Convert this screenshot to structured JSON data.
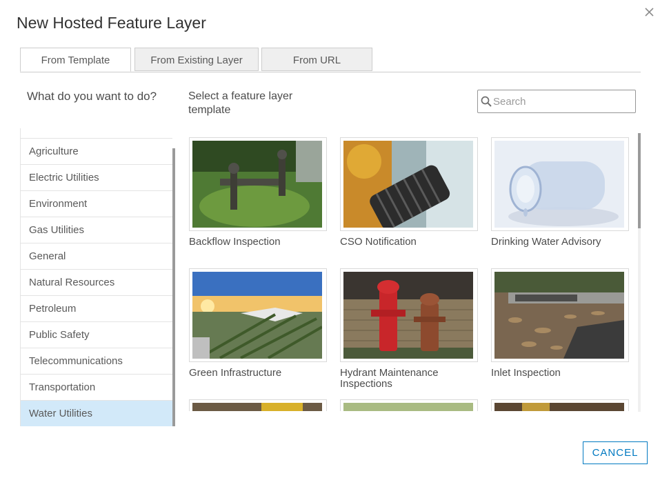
{
  "dialog": {
    "title": "New Hosted Feature Layer",
    "close_icon": "close-icon"
  },
  "tabs": [
    {
      "label": "From Template",
      "active": true
    },
    {
      "label": "From Existing Layer",
      "active": false
    },
    {
      "label": "From URL",
      "active": false
    }
  ],
  "left_panel": {
    "heading": "What do you want to do?",
    "categories": [
      "Agriculture",
      "Electric Utilities",
      "Environment",
      "Gas Utilities",
      "General",
      "Natural Resources",
      "Petroleum",
      "Public Safety",
      "Telecommunications",
      "Transportation",
      "Water Utilities"
    ],
    "selected": "Water Utilities"
  },
  "right_panel": {
    "heading": "Select a feature layer template",
    "search": {
      "placeholder": "Search",
      "value": "",
      "icon": "search-icon"
    },
    "templates": [
      {
        "label": "Backflow Inspection",
        "thumb": "backflow-thumbnail"
      },
      {
        "label": "CSO Notification",
        "thumb": "cso-thumbnail"
      },
      {
        "label": "Drinking Water Advisory",
        "thumb": "drinking-water-thumbnail"
      },
      {
        "label": "Green Infrastructure",
        "thumb": "green-infrastructure-thumbnail"
      },
      {
        "label": "Hydrant Maintenance Inspections",
        "thumb": "hydrant-thumbnail"
      },
      {
        "label": "Inlet Inspection",
        "thumb": "inlet-thumbnail"
      }
    ]
  },
  "footer": {
    "cancel_label": "CANCEL"
  },
  "colors": {
    "accent": "#0079c1",
    "selected_bg": "#d2e9f9",
    "border": "#cccccc"
  }
}
